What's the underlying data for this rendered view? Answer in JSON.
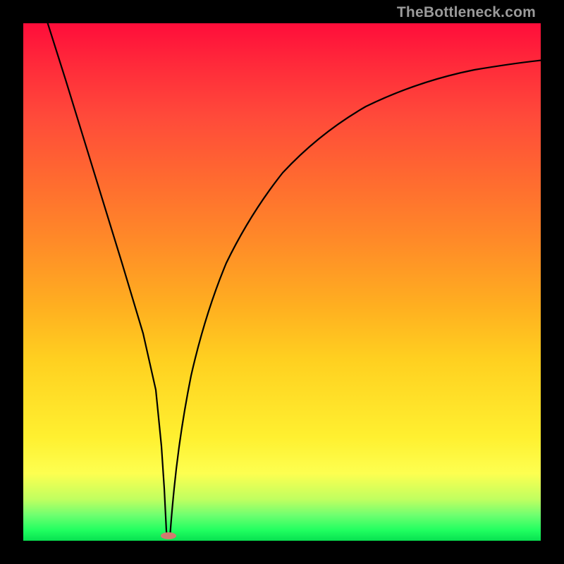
{
  "watermark": "TheBottleneck.com",
  "chart_data": {
    "type": "line",
    "title": "",
    "xlabel": "",
    "ylabel": "",
    "xlim": [
      0,
      100
    ],
    "ylim": [
      0,
      100
    ],
    "minimum_x": 27,
    "series": [
      {
        "name": "bottleneck-curve",
        "x": [
          0,
          5,
          10,
          15,
          20,
          24,
          26,
          27,
          28,
          30,
          34,
          40,
          48,
          58,
          70,
          84,
          100
        ],
        "values": [
          130,
          108,
          84,
          60,
          36,
          12,
          3,
          0,
          3,
          12,
          30,
          48,
          63,
          75,
          83,
          88,
          90
        ]
      }
    ],
    "background_gradient_stops": [
      {
        "pos": 0.0,
        "color": "#ff0d3a"
      },
      {
        "pos": 0.3,
        "color": "#ff6a30"
      },
      {
        "pos": 0.65,
        "color": "#ffd020"
      },
      {
        "pos": 0.88,
        "color": "#fdff50"
      },
      {
        "pos": 1.0,
        "color": "#08e050"
      }
    ],
    "marker": {
      "x": 27,
      "y": 0,
      "shape": "pill",
      "color": "#d17b6f"
    }
  }
}
